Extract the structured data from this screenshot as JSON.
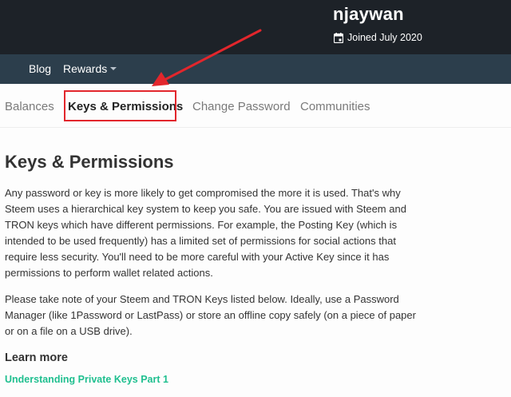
{
  "profile": {
    "username": "njaywan",
    "joined": "Joined July 2020",
    "joined_icon": "calendar-icon"
  },
  "subnav": {
    "blog": "Blog",
    "rewards": "Rewards"
  },
  "tabs": [
    {
      "label": "Balances"
    },
    {
      "label": "Keys & Permissions",
      "active": true
    },
    {
      "label": "Change Password"
    },
    {
      "label": "Communities"
    }
  ],
  "annotation": {
    "color": "#e2262c",
    "highlighted_tab": "Keys & Permissions"
  },
  "main": {
    "title": "Keys & Permissions",
    "paragraphs": [
      "Any password or key is more likely to get compromised the more it is used. That's why Steem uses a hierarchical key system to keep you safe. You are issued with Steem and TRON keys which have different permissions. For example, the Posting Key (which is intended to be used frequently) has a limited set of permissions for social actions that require less security. You'll need to be more careful with your Active Key since it has permissions to perform wallet related actions.",
      "Please take note of your Steem and TRON Keys listed below. Ideally, use a Password Manager (like 1Password or LastPass) or store an offline copy safely (on a piece of paper or on a file on a USB drive)."
    ],
    "learn_more_heading": "Learn more",
    "link_label": "Understanding Private Keys Part 1",
    "link_color": "#1fbf8f"
  }
}
